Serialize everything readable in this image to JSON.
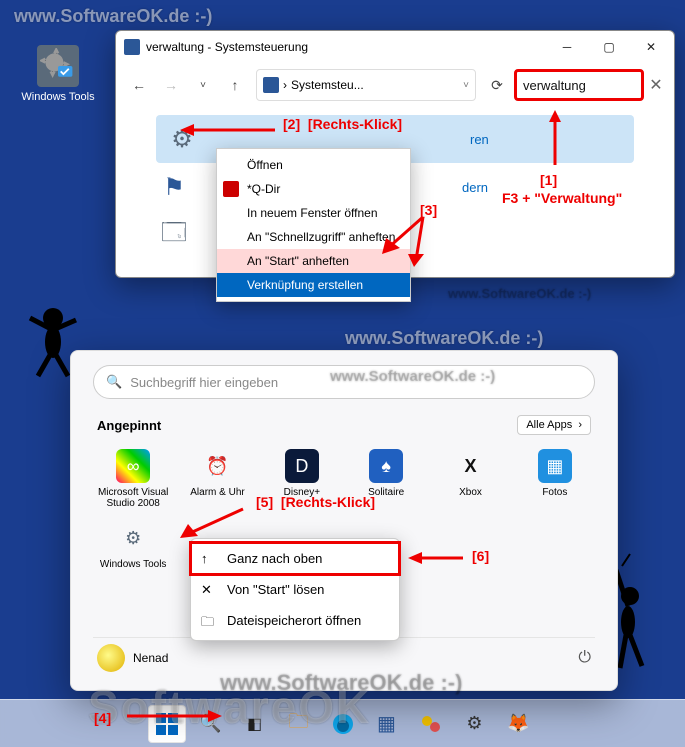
{
  "watermarks": [
    "www.SoftwareOK.de :-)"
  ],
  "desktop": {
    "icon_label": "Windows Tools"
  },
  "cp": {
    "title": "verwaltung - Systemsteuerung",
    "breadcrumb": "Systemsteu...",
    "search_value": "verwaltung",
    "row_links": {
      "r1": "ren",
      "r2": "dern"
    }
  },
  "ctx1": {
    "open": "Öffnen",
    "qdir": "*Q-Dir",
    "new_window": "In neuem Fenster öffnen",
    "pin_quick": "An \"Schnellzugriff\" anheften",
    "pin_start": "An \"Start\" anheften",
    "shortcut": "Verknüpfung erstellen"
  },
  "start": {
    "search_placeholder": "Suchbegriff hier eingeben",
    "pinned_label": "Angepinnt",
    "all_apps": "Alle Apps",
    "tiles": [
      {
        "label": "Microsoft Visual Studio 2008",
        "color": "#fff",
        "icon": "∞"
      },
      {
        "label": "Alarm & Uhr",
        "color": "#fff",
        "icon": "⏰"
      },
      {
        "label": "Disney+",
        "color": "#0a1a3a",
        "icon": "D"
      },
      {
        "label": "Solitaire",
        "color": "#2060c0",
        "icon": "♠"
      },
      {
        "label": "Xbox",
        "color": "#fff",
        "icon": "X"
      },
      {
        "label": "Fotos",
        "color": "#2090e0",
        "icon": "▦"
      },
      {
        "label": "Windows Tools",
        "color": "#eee",
        "icon": "⚙"
      }
    ],
    "user": "Nenad"
  },
  "ctx2": {
    "top": "Ganz nach oben",
    "unpin": "Von \"Start\" lösen",
    "open_loc": "Dateispeicherort öffnen"
  },
  "ann": {
    "a1": "[1]",
    "a1t": "F3 + \"Verwaltung\"",
    "a2": "[2]",
    "a2t": "[Rechts-Klick]",
    "a3": "[3]",
    "a4": "[4]",
    "a5": "[5]",
    "a5t": "[Rechts-Klick]",
    "a6": "[6]"
  }
}
